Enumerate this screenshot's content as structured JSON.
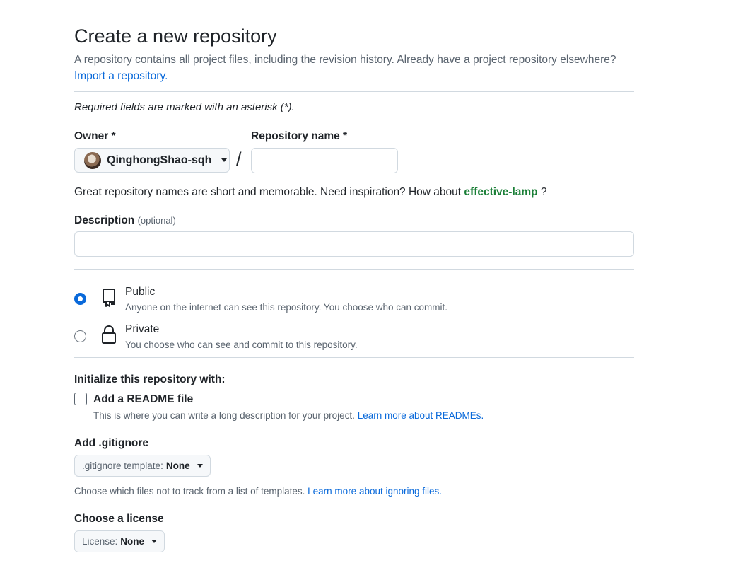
{
  "header": {
    "title": "Create a new repository",
    "subtitle": "A repository contains all project files, including the revision history. Already have a project repository elsewhere?",
    "import_link": "Import a repository."
  },
  "form": {
    "required_note": "Required fields are marked with an asterisk (*).",
    "owner_label": "Owner *",
    "owner_value": "QinghongShao-sqh",
    "slash": "/",
    "repo_name_label": "Repository name *",
    "repo_name_value": "",
    "hint_text": "Great repository names are short and memorable. Need inspiration? How about",
    "suggestion": "effective-lamp",
    "hint_end": "?",
    "description_label": "Description",
    "description_optional": "(optional)",
    "description_value": ""
  },
  "visibility": {
    "options": [
      {
        "label": "Public",
        "description": "Anyone on the internet can see this repository. You choose who can commit.",
        "selected": true,
        "icon": "repo-icon"
      },
      {
        "label": "Private",
        "description": "You choose who can see and commit to this repository.",
        "selected": false,
        "icon": "lock-icon"
      }
    ]
  },
  "initialize": {
    "heading": "Initialize this repository with:",
    "readme_label": "Add a README file",
    "readme_checked": false,
    "readme_desc": "This is where you can write a long description for your project.",
    "readme_link": "Learn more about READMEs."
  },
  "gitignore": {
    "heading": "Add .gitignore",
    "select_key": ".gitignore template:",
    "select_value": "None",
    "desc": "Choose which files not to track from a list of templates.",
    "link": "Learn more about ignoring files."
  },
  "license": {
    "heading": "Choose a license",
    "select_key": "License:",
    "select_value": "None"
  },
  "colors": {
    "accent": "#0969da",
    "suggestion_green": "#1a7f37",
    "border": "#d1d9e0",
    "muted_text": "#59636e"
  }
}
